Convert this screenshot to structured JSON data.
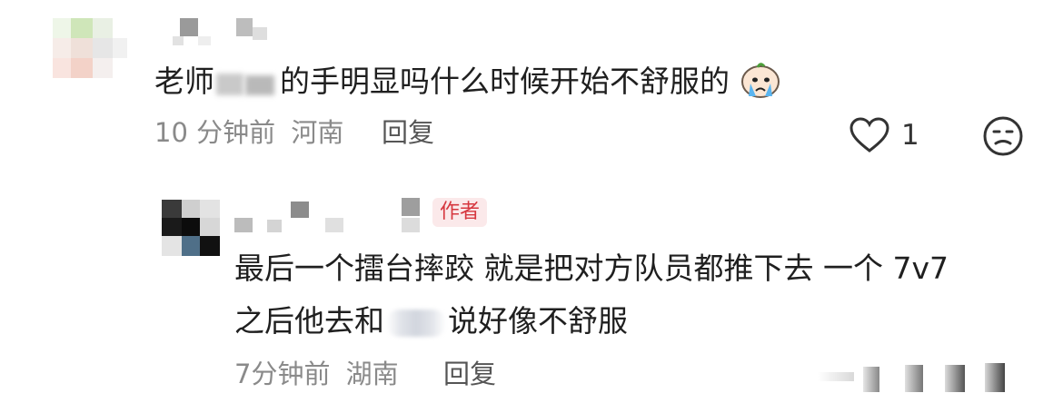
{
  "comment": {
    "text_part1": "老师",
    "text_part2": "的手明显吗什么时候开始不舒服的",
    "emoji_icon": "crying-emoji-icon",
    "time": "10 分钟前",
    "location": "河南",
    "reply_label": "回复",
    "like_count": "1",
    "like_icon": "heart-icon",
    "dislike_icon": "unhappy-face-icon"
  },
  "reply": {
    "author_badge": "作者",
    "line1": "最后一个擂台摔跤 就是把对方队员都推下去 一个 7v7",
    "line2_before": "之后他去和",
    "line2_after": "说好像不舒服",
    "time": "7分钟前",
    "location": "湖南",
    "reply_label": "回复"
  },
  "colors": {
    "text": "#1f1f1f",
    "meta": "#8a8a8a",
    "author_badge_text": "#d6373f",
    "author_badge_bg": "#fbe9ea"
  }
}
